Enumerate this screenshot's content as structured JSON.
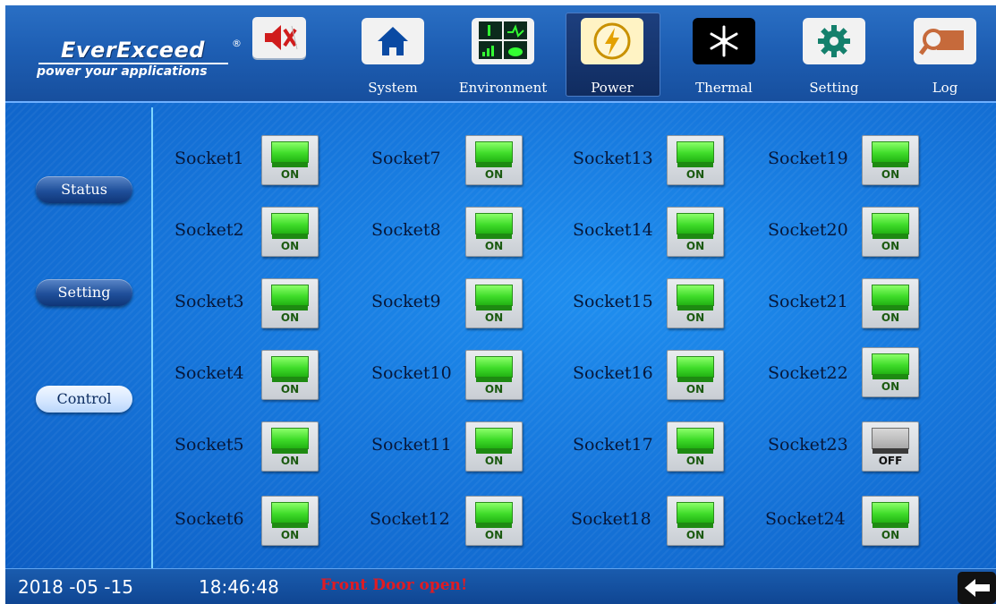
{
  "brand": {
    "name": "EverExceed",
    "registered": "®",
    "tagline": "power your applications"
  },
  "nav": [
    {
      "label": "System",
      "icon": "home-icon"
    },
    {
      "label": "Environment",
      "icon": "environment-icon"
    },
    {
      "label": "Power",
      "icon": "power-icon",
      "active": true
    },
    {
      "label": "Thermal",
      "icon": "thermal-icon"
    },
    {
      "label": "Setting",
      "icon": "gear-icon"
    },
    {
      "label": "Log",
      "icon": "log-icon"
    }
  ],
  "mute_icon": "mute-icon",
  "sidebar": {
    "items": [
      {
        "label": "Status"
      },
      {
        "label": "Setting"
      },
      {
        "label": "Control",
        "active": true
      }
    ]
  },
  "sockets": [
    {
      "label": "Socket1",
      "state": "ON"
    },
    {
      "label": "Socket2",
      "state": "ON"
    },
    {
      "label": "Socket3",
      "state": "ON"
    },
    {
      "label": "Socket4",
      "state": "ON"
    },
    {
      "label": "Socket5",
      "state": "ON"
    },
    {
      "label": "Socket6",
      "state": "ON"
    },
    {
      "label": "Socket7",
      "state": "ON"
    },
    {
      "label": "Socket8",
      "state": "ON"
    },
    {
      "label": "Socket9",
      "state": "ON"
    },
    {
      "label": "Socket10",
      "state": "ON"
    },
    {
      "label": "Socket11",
      "state": "ON"
    },
    {
      "label": "Socket12",
      "state": "ON"
    },
    {
      "label": "Socket13",
      "state": "ON"
    },
    {
      "label": "Socket14",
      "state": "ON"
    },
    {
      "label": "Socket15",
      "state": "ON"
    },
    {
      "label": "Socket16",
      "state": "ON"
    },
    {
      "label": "Socket17",
      "state": "ON"
    },
    {
      "label": "Socket18",
      "state": "ON"
    },
    {
      "label": "Socket19",
      "state": "ON"
    },
    {
      "label": "Socket20",
      "state": "ON"
    },
    {
      "label": "Socket21",
      "state": "ON"
    },
    {
      "label": "Socket22",
      "state": "ON"
    },
    {
      "label": "Socket23",
      "state": "OFF"
    },
    {
      "label": "Socket24",
      "state": "ON"
    }
  ],
  "status": {
    "date": "2018 -05 -15",
    "time": "18:46:48",
    "alarm": "Front Door open!",
    "back_icon": "back-arrow-icon"
  },
  "colors": {
    "accent": "#1778dd",
    "on": "#3fdc2a",
    "alarm": "#e11b22",
    "divider": "#7fd6ff"
  }
}
